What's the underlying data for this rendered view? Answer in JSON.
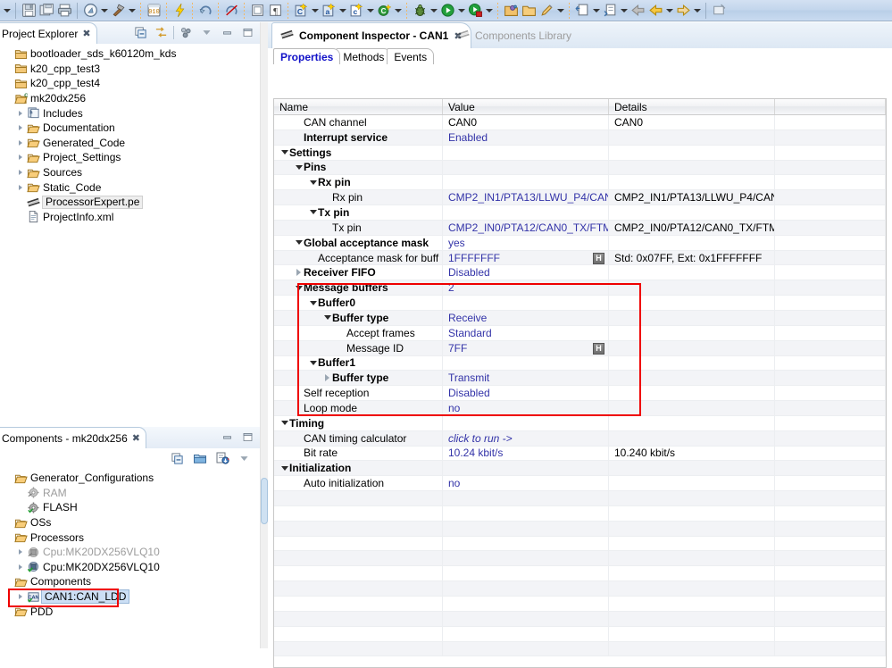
{
  "toolbar": {
    "groups": [
      {
        "items": [
          {
            "icon": "dropdown-arrow",
            "name": "nav-history-dropdown",
            "arrow": false,
            "glyph": "▾"
          }
        ]
      },
      {
        "items": [
          {
            "icon": "save-icon",
            "name": "save-button",
            "glyph": "💾"
          },
          {
            "icon": "save-all-icon",
            "name": "save-all-button",
            "glyph": "🗐"
          },
          {
            "icon": "print-icon",
            "name": "print-button",
            "glyph": "🖨"
          }
        ]
      },
      {
        "items": [
          {
            "icon": "build-icon",
            "name": "build-button",
            "glyph": "◉",
            "arrow": true
          },
          {
            "icon": "hammer-icon",
            "name": "build-project-button",
            "glyph": "🔨",
            "arrow": true
          }
        ]
      },
      {
        "items": [
          {
            "icon": "binary-icon",
            "name": "binary-view-button",
            "glyph": "010"
          },
          {
            "icon": "lightning-icon",
            "name": "flash-button",
            "glyph": "⚡"
          },
          {
            "icon": "debug-config-icon",
            "name": "debug-config-button",
            "glyph": "↻"
          },
          {
            "icon": "skip-breakpoints-icon",
            "name": "skip-breakpoints-button",
            "glyph": "⊘"
          }
        ]
      },
      {
        "items": [
          {
            "icon": "console-icon",
            "name": "console-button",
            "glyph": "▣"
          },
          {
            "icon": "paragraph-icon",
            "name": "paragraph-button",
            "glyph": "¶"
          }
        ]
      },
      {
        "items": [
          {
            "icon": "new-c-file-icon",
            "name": "new-c-file-button",
            "glyph": "C",
            "arrow": true
          },
          {
            "icon": "new-header-file-icon",
            "name": "new-header-file-button",
            "glyph": "a",
            "arrow": true
          },
          {
            "icon": "new-c-source-icon",
            "name": "new-c-source-button",
            "glyph": "c",
            "arrow": true
          },
          {
            "icon": "new-class-icon",
            "name": "new-class-button",
            "glyph": "G",
            "arrow": true
          }
        ]
      },
      {
        "items": [
          {
            "icon": "debug-bug-icon",
            "name": "debug-button",
            "glyph": "🐞",
            "arrow": true
          },
          {
            "icon": "run-icon",
            "name": "run-button",
            "glyph": "▶",
            "arrow": true
          },
          {
            "icon": "profile-icon",
            "name": "profile-button",
            "glyph": "▶",
            "arrow": true
          }
        ]
      },
      {
        "items": [
          {
            "icon": "open-resource-icon",
            "name": "open-resource-button",
            "glyph": "📂"
          },
          {
            "icon": "open-folder-icon",
            "name": "open-folder-button",
            "glyph": "📁"
          },
          {
            "icon": "pencil-icon",
            "name": "edit-button",
            "glyph": "✏",
            "arrow": true
          }
        ]
      },
      {
        "items": [
          {
            "icon": "export-icon",
            "name": "export-button",
            "glyph": "⤓",
            "arrow": true
          },
          {
            "icon": "next-annotation-icon",
            "name": "next-annotation-button",
            "glyph": "⇥",
            "arrow": true
          },
          {
            "icon": "back-icon",
            "name": "back-button",
            "glyph": "⬅"
          },
          {
            "icon": "previous-icon",
            "name": "previous-edit-button",
            "glyph": "⬅",
            "arrow": true
          },
          {
            "icon": "forward-icon",
            "name": "forward-button",
            "glyph": "➡",
            "arrow": true
          }
        ]
      },
      {
        "items": [
          {
            "icon": "pin-editor-icon",
            "name": "pin-editor-button",
            "glyph": "🗗"
          }
        ]
      }
    ]
  },
  "project_explorer": {
    "title": "Project Explorer",
    "close_glyph": "✖",
    "tools": [
      {
        "name": "collapse-all-icon",
        "glyph": "▤"
      },
      {
        "name": "link-with-editor-icon",
        "glyph": "⇄"
      },
      {
        "name": "view-menu-filter-icon",
        "glyph": "⁂"
      },
      {
        "name": "view-menu-icon",
        "glyph": "▽"
      },
      {
        "name": "minimize-icon",
        "glyph": "▬"
      },
      {
        "name": "maximize-icon",
        "glyph": "❐"
      }
    ],
    "tree": [
      {
        "label": "bootloader_sds_k60120m_kds",
        "indent": 0,
        "arrow": false,
        "icon": "closed-project-icon",
        "gray": false,
        "selected": false
      },
      {
        "label": "k20_cpp_test3",
        "indent": 0,
        "arrow": false,
        "icon": "closed-project-icon",
        "gray": false,
        "selected": false
      },
      {
        "label": "k20_cpp_test4",
        "indent": 0,
        "arrow": false,
        "icon": "closed-project-icon",
        "gray": false,
        "selected": false
      },
      {
        "label": "mk20dx256",
        "indent": 0,
        "arrow": false,
        "icon": "open-c-project-icon",
        "gray": false,
        "selected": false
      },
      {
        "label": "Includes",
        "indent": 1,
        "arrow": true,
        "icon": "includes-icon",
        "gray": false,
        "selected": false
      },
      {
        "label": "Documentation",
        "indent": 1,
        "arrow": true,
        "icon": "folder-icon",
        "gray": false,
        "selected": false
      },
      {
        "label": "Generated_Code",
        "indent": 1,
        "arrow": true,
        "icon": "folder-icon",
        "gray": false,
        "selected": false
      },
      {
        "label": "Project_Settings",
        "indent": 1,
        "arrow": true,
        "icon": "folder-icon",
        "gray": false,
        "selected": false
      },
      {
        "label": "Sources",
        "indent": 1,
        "arrow": true,
        "icon": "folder-icon",
        "gray": false,
        "selected": false
      },
      {
        "label": "Static_Code",
        "indent": 1,
        "arrow": true,
        "icon": "folder-icon",
        "gray": false,
        "selected": false
      },
      {
        "label": "ProcessorExpert.pe",
        "indent": 1,
        "arrow": false,
        "icon": "pe-file-icon",
        "gray": false,
        "selected": true
      },
      {
        "label": "ProjectInfo.xml",
        "indent": 1,
        "arrow": false,
        "icon": "xml-file-icon",
        "gray": false,
        "selected": false
      }
    ]
  },
  "components_view": {
    "title": "Components - mk20dx256",
    "close_glyph": "✖",
    "window_buttons": [
      {
        "name": "minimize-icon",
        "glyph": "▬"
      },
      {
        "name": "maximize-icon",
        "glyph": "❐"
      }
    ],
    "tools": [
      {
        "name": "collapse-all-icon",
        "glyph": "▤"
      },
      {
        "name": "new-configuration-icon",
        "glyph": "▭"
      },
      {
        "name": "import-component-icon",
        "glyph": "⎘"
      },
      {
        "name": "view-menu-icon",
        "glyph": "▽"
      }
    ],
    "tree": [
      {
        "label": "Generator_Configurations",
        "indent": 0,
        "arrow": false,
        "icon": "folder-icon",
        "gray": false,
        "selected": false
      },
      {
        "label": "RAM",
        "indent": 1,
        "arrow": false,
        "icon": "gear-disabled-icon",
        "gray": true,
        "selected": false
      },
      {
        "label": "FLASH",
        "indent": 1,
        "arrow": false,
        "icon": "gear-enabled-icon",
        "gray": false,
        "selected": false
      },
      {
        "label": "OSs",
        "indent": 0,
        "arrow": false,
        "icon": "folder-icon",
        "gray": false,
        "selected": false
      },
      {
        "label": "Processors",
        "indent": 0,
        "arrow": false,
        "icon": "folder-icon",
        "gray": false,
        "selected": false
      },
      {
        "label": "Cpu:MK20DX256VLQ10",
        "indent": 1,
        "arrow": true,
        "icon": "cpu-disabled-icon",
        "gray": true,
        "selected": false
      },
      {
        "label": "Cpu:MK20DX256VLQ10",
        "indent": 1,
        "arrow": true,
        "icon": "cpu-enabled-icon",
        "gray": false,
        "selected": false
      },
      {
        "label": "Components",
        "indent": 0,
        "arrow": false,
        "icon": "folder-icon",
        "gray": false,
        "selected": false
      },
      {
        "label": "CAN1:CAN_LDD",
        "indent": 1,
        "arrow": true,
        "icon": "can-component-icon",
        "gray": false,
        "selected": true
      },
      {
        "label": "PDD",
        "indent": 0,
        "arrow": false,
        "icon": "folder-icon",
        "gray": false,
        "selected": false
      }
    ]
  },
  "editor": {
    "tabs": [
      {
        "label": "Component Inspector - CAN1",
        "active": true,
        "icon": "pe-file-icon",
        "close": "✖"
      },
      {
        "label": "Components Library",
        "active": false,
        "icon": "pe-file-icon",
        "close": ""
      }
    ],
    "property_tabs": [
      {
        "label": "Properties",
        "active": true
      },
      {
        "label": "Methods",
        "active": false
      },
      {
        "label": "Events",
        "active": false
      }
    ],
    "table": {
      "columns": [
        "Name",
        "Value",
        "Details",
        ""
      ],
      "rows": [
        {
          "name": "CAN channel",
          "indent": 1,
          "expander": "none",
          "bold": false,
          "value": "CAN0",
          "value_style": "black",
          "details": "CAN0",
          "hbtn": false
        },
        {
          "name": "Interrupt service",
          "indent": 1,
          "expander": "none",
          "bold": true,
          "value": "Enabled",
          "value_style": "link",
          "details": "",
          "hbtn": false
        },
        {
          "name": "Settings",
          "indent": 0,
          "expander": "open",
          "bold": true,
          "value": "",
          "value_style": "link",
          "details": "",
          "hbtn": false
        },
        {
          "name": "Pins",
          "indent": 1,
          "expander": "open",
          "bold": true,
          "value": "",
          "value_style": "link",
          "details": "",
          "hbtn": false
        },
        {
          "name": "Rx pin",
          "indent": 2,
          "expander": "open",
          "bold": true,
          "value": "",
          "value_style": "link",
          "details": "",
          "hbtn": false
        },
        {
          "name": "Rx pin",
          "indent": 3,
          "expander": "none",
          "bold": false,
          "value": "CMP2_IN1/PTA13/LLWU_P4/CAN...",
          "value_style": "link",
          "details": "CMP2_IN1/PTA13/LLWU_P4/CAN...",
          "hbtn": false
        },
        {
          "name": "Tx pin",
          "indent": 2,
          "expander": "open",
          "bold": true,
          "value": "",
          "value_style": "link",
          "details": "",
          "hbtn": false
        },
        {
          "name": "Tx pin",
          "indent": 3,
          "expander": "none",
          "bold": false,
          "value": "CMP2_IN0/PTA12/CAN0_TX/FTM...",
          "value_style": "link",
          "details": "CMP2_IN0/PTA12/CAN0_TX/FTM...",
          "hbtn": false
        },
        {
          "name": "Global acceptance mask",
          "indent": 1,
          "expander": "open",
          "bold": true,
          "value": "yes",
          "value_style": "link",
          "details": "",
          "hbtn": false
        },
        {
          "name": "Acceptance mask for buff",
          "indent": 2,
          "expander": "none",
          "bold": false,
          "value": "1FFFFFFF",
          "value_style": "link",
          "details": "Std: 0x07FF, Ext: 0x1FFFFFFF",
          "hbtn": true
        },
        {
          "name": "Receiver FIFO",
          "indent": 1,
          "expander": "closed",
          "bold": true,
          "value": "Disabled",
          "value_style": "link",
          "details": "",
          "hbtn": false
        },
        {
          "name": "Message buffers",
          "indent": 1,
          "expander": "open",
          "bold": true,
          "value": "2",
          "value_style": "link",
          "details": "",
          "hbtn": false
        },
        {
          "name": "Buffer0",
          "indent": 2,
          "expander": "open",
          "bold": true,
          "value": "",
          "value_style": "link",
          "details": "",
          "hbtn": false
        },
        {
          "name": "Buffer type",
          "indent": 3,
          "expander": "open",
          "bold": true,
          "value": "Receive",
          "value_style": "link",
          "details": "",
          "hbtn": false
        },
        {
          "name": "Accept frames",
          "indent": 4,
          "expander": "none",
          "bold": false,
          "value": "Standard",
          "value_style": "link",
          "details": "",
          "hbtn": false
        },
        {
          "name": "Message ID",
          "indent": 4,
          "expander": "none",
          "bold": false,
          "value": "7FF",
          "value_style": "link",
          "details": "",
          "hbtn": true
        },
        {
          "name": "Buffer1",
          "indent": 2,
          "expander": "open",
          "bold": true,
          "value": "",
          "value_style": "link",
          "details": "",
          "hbtn": false
        },
        {
          "name": "Buffer type",
          "indent": 3,
          "expander": "closed",
          "bold": true,
          "value": "Transmit",
          "value_style": "link",
          "details": "",
          "hbtn": false
        },
        {
          "name": "Self reception",
          "indent": 1,
          "expander": "none",
          "bold": false,
          "value": "Disabled",
          "value_style": "link",
          "details": "",
          "hbtn": false
        },
        {
          "name": "Loop mode",
          "indent": 1,
          "expander": "none",
          "bold": false,
          "value": "no",
          "value_style": "link",
          "details": "",
          "hbtn": false
        },
        {
          "name": "Timing",
          "indent": 0,
          "expander": "open",
          "bold": true,
          "value": "",
          "value_style": "link",
          "details": "",
          "hbtn": false
        },
        {
          "name": "CAN timing calculator",
          "indent": 1,
          "expander": "none",
          "bold": false,
          "value": "click to run ->",
          "value_style": "italic",
          "details": "",
          "hbtn": false
        },
        {
          "name": "Bit rate",
          "indent": 1,
          "expander": "none",
          "bold": false,
          "value": "10.24 kbit/s",
          "value_style": "link",
          "details": "10.240 kbit/s",
          "hbtn": false
        },
        {
          "name": "Initialization",
          "indent": 0,
          "expander": "open",
          "bold": true,
          "value": "",
          "value_style": "link",
          "details": "",
          "hbtn": false
        },
        {
          "name": "Auto initialization",
          "indent": 1,
          "expander": "none",
          "bold": false,
          "value": "no",
          "value_style": "link",
          "details": "",
          "hbtn": false
        }
      ]
    }
  },
  "colors": {
    "highlight_box": "#ef0000",
    "value_link": "#3333a8",
    "active_tab_text": "#1111c8",
    "selection_bg": "#ccdff5",
    "toolbar_bg": "#c3d6ec"
  }
}
